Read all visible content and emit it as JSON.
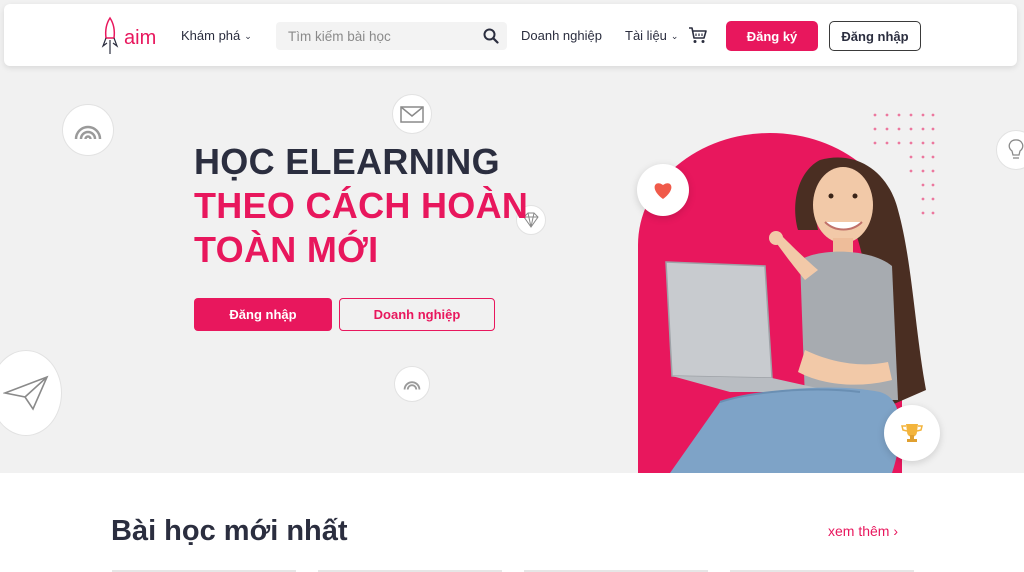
{
  "header": {
    "logo_text": "aim",
    "nav_explore": "Khám phá",
    "search_placeholder": "Tìm kiếm bài học",
    "nav_business": "Doanh nghiệp",
    "nav_docs": "Tài liệu",
    "register_label": "Đăng ký",
    "login_label": "Đăng nhập"
  },
  "hero": {
    "title_line1": "HỌC ELEARNING",
    "title_line2": "THEO CÁCH HOÀN",
    "title_line3": "TOÀN MỚI",
    "login_button": "Đăng nhập",
    "business_button": "Doanh nghiệp"
  },
  "latest": {
    "title": "Bài học mới nhất",
    "see_more": "xem thêm ›"
  },
  "colors": {
    "accent": "#e8175d",
    "text_dark": "#2b2e3f",
    "hero_bg": "#f1f1f1"
  },
  "icons": [
    "rocket-logo-icon",
    "search-icon",
    "cart-icon",
    "chevron-down-icon",
    "heart-icon",
    "trophy-icon",
    "wifi-icon",
    "mail-icon",
    "diamond-icon",
    "paper-plane-icon",
    "lightbulb-icon"
  ]
}
